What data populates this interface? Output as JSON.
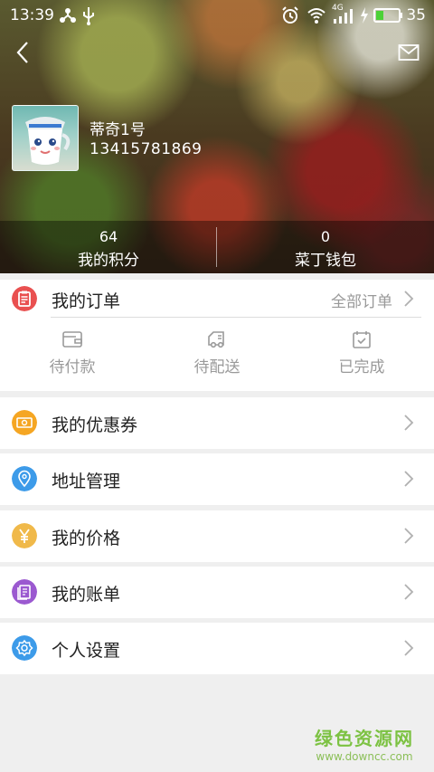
{
  "status_bar": {
    "time": "13:39",
    "network": "4G",
    "battery": "35",
    "icons": [
      "share-icon",
      "usb-icon",
      "alarm-icon",
      "wifi-icon",
      "signal-icon",
      "charging-icon",
      "battery-icon"
    ]
  },
  "header": {
    "back_icon": "chevron-left-icon",
    "mail_icon": "mail-icon"
  },
  "profile": {
    "name": "蒂奇1号",
    "phone": "13415781869"
  },
  "stats": [
    {
      "value": "64",
      "label": "我的积分"
    },
    {
      "value": "0",
      "label": "菜丁钱包"
    }
  ],
  "orders": {
    "title": "我的订单",
    "all_link": "全部订单",
    "statuses": [
      {
        "label": "待付款",
        "icon": "wallet-icon"
      },
      {
        "label": "待配送",
        "icon": "truck-icon"
      },
      {
        "label": "已完成",
        "icon": "calendar-check-icon"
      }
    ]
  },
  "menu": [
    {
      "label": "我的优惠券",
      "icon": "coupon-icon",
      "color": "#f5a623"
    },
    {
      "label": "地址管理",
      "icon": "location-icon",
      "color": "#3d9be9"
    },
    {
      "label": "我的价格",
      "icon": "yen-icon",
      "color": "#f0b94a"
    },
    {
      "label": "我的账单",
      "icon": "bill-icon",
      "color": "#9b59d0"
    },
    {
      "label": "个人设置",
      "icon": "settings-icon",
      "color": "#3d9be9"
    }
  ],
  "colors": {
    "orders_icon": "#e95050",
    "chevron": "#b0b0b0",
    "muted_text": "#999999"
  },
  "watermark": {
    "title": "绿色资源网",
    "url": "www.downcc.com"
  }
}
